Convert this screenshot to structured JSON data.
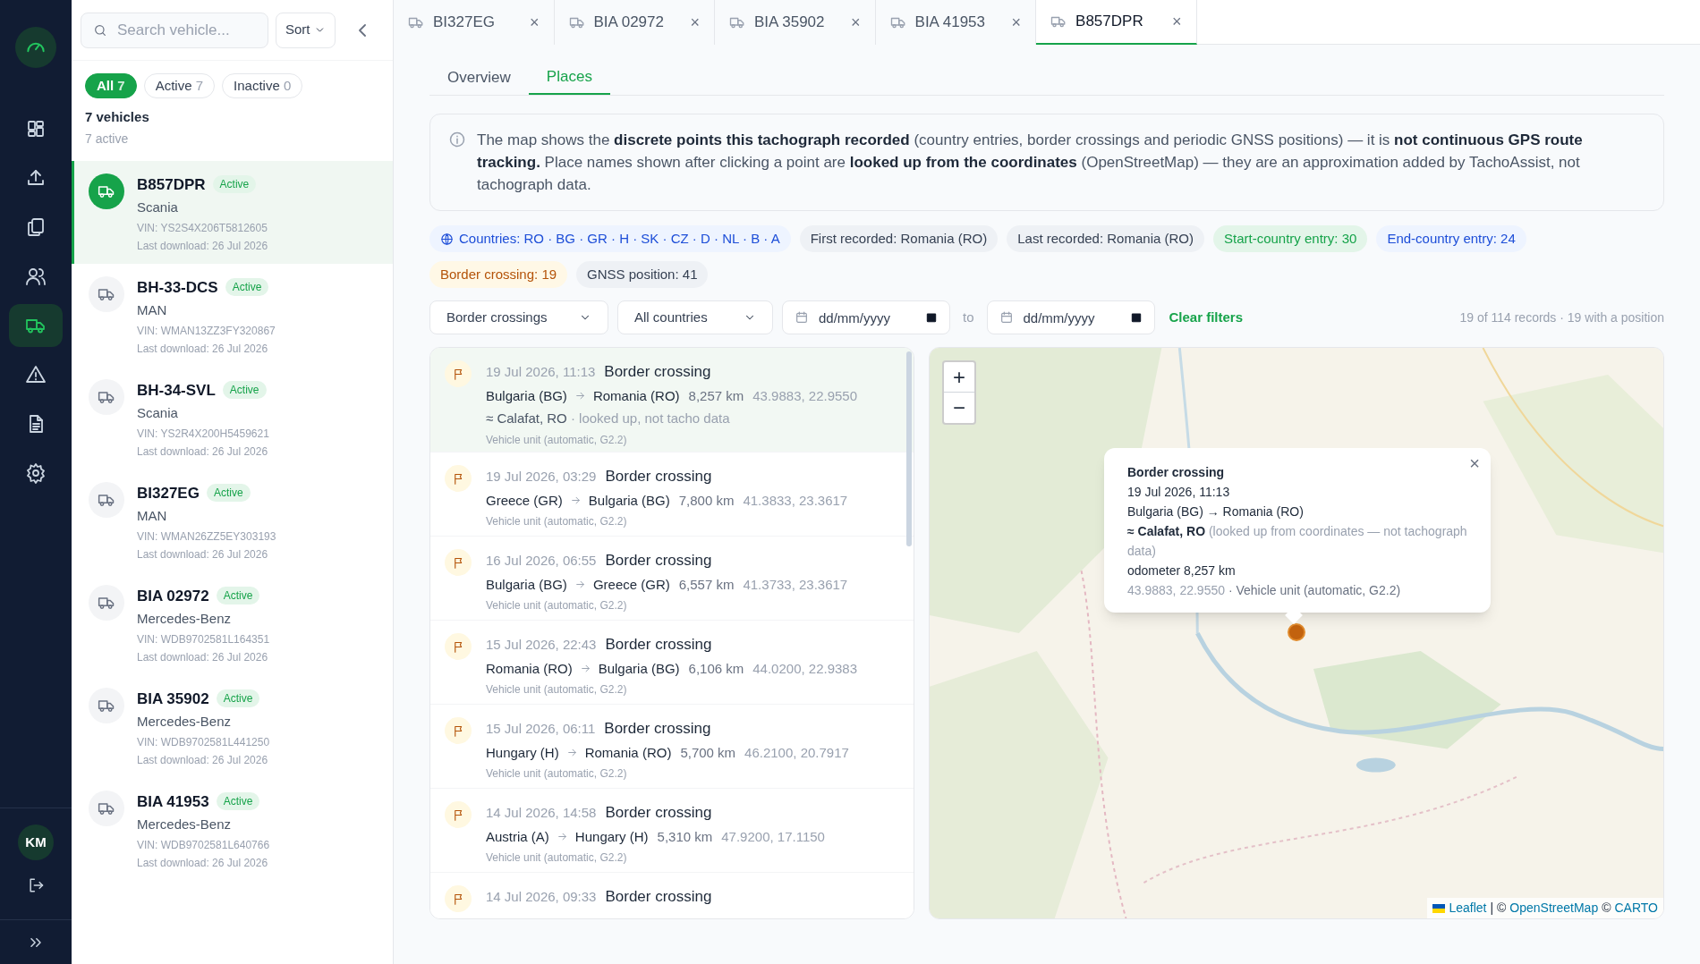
{
  "nav": {
    "items": [
      {
        "kind": "dashboard",
        "selected": false
      },
      {
        "kind": "upload",
        "selected": false
      },
      {
        "kind": "documents",
        "selected": false
      },
      {
        "kind": "drivers",
        "selected": false
      },
      {
        "kind": "vehicles",
        "selected": true
      },
      {
        "kind": "alerts",
        "selected": false
      },
      {
        "kind": "reports",
        "selected": false
      },
      {
        "kind": "settings",
        "selected": false
      }
    ],
    "avatar": "KM",
    "bottom": [
      {
        "kind": "logout"
      },
      {
        "kind": "expand"
      }
    ]
  },
  "vehicle_panel": {
    "search": {
      "placeholder": "Search vehicle..."
    },
    "sort": "Sort",
    "filters": [
      {
        "label": "All",
        "count": "7",
        "selected": true
      },
      {
        "label": "Active",
        "count": "7",
        "selected": false
      },
      {
        "label": "Inactive",
        "count": "0",
        "selected": false
      }
    ],
    "summary": "7 vehicles",
    "summary_sub": "7 active",
    "vehicles": [
      {
        "plate": "B857DPR",
        "status": "Active",
        "make": "Scania",
        "vin": "VIN: YS2S4X206T5812605",
        "last_download": "Last download: 26 Jul 2026",
        "selected": true
      },
      {
        "plate": "BH-33-DCS",
        "status": "Active",
        "make": "MAN",
        "vin": "VIN: WMAN13ZZ3FY320867",
        "last_download": "Last download: 26 Jul 2026",
        "selected": false
      },
      {
        "plate": "BH-34-SVL",
        "status": "Active",
        "make": "Scania",
        "vin": "VIN: YS2R4X200H5459621",
        "last_download": "Last download: 26 Jul 2026",
        "selected": false
      },
      {
        "plate": "BI327EG",
        "status": "Active",
        "make": "MAN",
        "vin": "VIN: WMAN26ZZ5EY303193",
        "last_download": "Last download: 26 Jul 2026",
        "selected": false
      },
      {
        "plate": "BIA 02972",
        "status": "Active",
        "make": "Mercedes-Benz",
        "vin": "VIN: WDB9702581L164351",
        "last_download": "Last download: 26 Jul 2026",
        "selected": false
      },
      {
        "plate": "BIA 35902",
        "status": "Active",
        "make": "Mercedes-Benz",
        "vin": "VIN: WDB9702581L441250",
        "last_download": "Last download: 26 Jul 2026",
        "selected": false
      },
      {
        "plate": "BIA 41953",
        "status": "Active",
        "make": "Mercedes-Benz",
        "vin": "VIN: WDB9702581L640766",
        "last_download": "Last download: 26 Jul 2026",
        "selected": false
      }
    ]
  },
  "tabs": [
    {
      "label": "BI327EG",
      "close": "×",
      "selected": false
    },
    {
      "label": "BIA 02972",
      "close": "×",
      "selected": false
    },
    {
      "label": "BIA 35902",
      "close": "×",
      "selected": false
    },
    {
      "label": "BIA 41953",
      "close": "×",
      "selected": false
    },
    {
      "label": "B857DPR",
      "close": "×",
      "selected": true
    }
  ],
  "subtabs": [
    {
      "label": "Overview",
      "selected": false
    },
    {
      "label": "Places",
      "selected": true
    }
  ],
  "info": "The map shows the **discrete points this tachograph recorded** (country entries, border crossings and periodic GNSS positions) — it is **not continuous GPS route tracking.** Place names shown after clicking a point are **looked up from the coordinates** (OpenStreetMap) — they are an approximation added by TachoAssist, not tachograph data.",
  "chips": [
    {
      "kind": "countries",
      "label": "Countries: RO · BG · GR · H · SK · CZ · D · NL · B · A"
    },
    {
      "kind": "neutral",
      "label": "First recorded: Romania (RO)"
    },
    {
      "kind": "neutral",
      "label": "Last recorded: Romania (RO)"
    },
    {
      "kind": "green",
      "label": "Start-country entry: 30"
    },
    {
      "kind": "blue",
      "label": "End-country entry: 24"
    },
    {
      "kind": "amber",
      "label": "Border crossing: 19"
    },
    {
      "kind": "neutral",
      "label": "GNSS position: 41"
    }
  ],
  "filter_bar": {
    "type_select": "Border crossings",
    "country_select": "All countries",
    "date_from": {
      "placeholder": "dd/mm/yyyy"
    },
    "to": "to",
    "date_to": {
      "placeholder": "dd/mm/yyyy"
    },
    "clear": "Clear filters",
    "records": "19 of 114 records · 19 with a position"
  },
  "events": [
    {
      "time": "19 Jul 2026, 11:13",
      "title": "Border crossing",
      "from": "Bulgaria (BG)",
      "to": "Romania (RO)",
      "km": "8,257 km",
      "coords": "43.9883, 22.9550",
      "place": "≈ Calafat, RO",
      "place_note": "· looked up, not tacho data",
      "source": "Vehicle unit (automatic, G2.2)",
      "selected": true
    },
    {
      "time": "19 Jul 2026, 03:29",
      "title": "Border crossing",
      "from": "Greece (GR)",
      "to": "Bulgaria (BG)",
      "km": "7,800 km",
      "coords": "41.3833, 23.3617",
      "source": "Vehicle unit (automatic, G2.2)",
      "selected": false
    },
    {
      "time": "16 Jul 2026, 06:55",
      "title": "Border crossing",
      "from": "Bulgaria (BG)",
      "to": "Greece (GR)",
      "km": "6,557 km",
      "coords": "41.3733, 23.3617",
      "source": "Vehicle unit (automatic, G2.2)",
      "selected": false
    },
    {
      "time": "15 Jul 2026, 22:43",
      "title": "Border crossing",
      "from": "Romania (RO)",
      "to": "Bulgaria (BG)",
      "km": "6,106 km",
      "coords": "44.0200, 22.9383",
      "source": "Vehicle unit (automatic, G2.2)",
      "selected": false
    },
    {
      "time": "15 Jul 2026, 06:11",
      "title": "Border crossing",
      "from": "Hungary (H)",
      "to": "Romania (RO)",
      "km": "5,700 km",
      "coords": "46.2100, 20.7917",
      "source": "Vehicle unit (automatic, G2.2)",
      "selected": false
    },
    {
      "time": "14 Jul 2026, 14:58",
      "title": "Border crossing",
      "from": "Austria (A)",
      "to": "Hungary (H)",
      "km": "5,310 km",
      "coords": "47.9200, 17.1150",
      "source": "Vehicle unit (automatic, G2.2)",
      "selected": false
    },
    {
      "time": "14 Jul 2026, 09:33",
      "title": "Border crossing",
      "selected": false
    }
  ],
  "map": {
    "kind": "picture",
    "zoom_in": "+",
    "zoom_out": "−",
    "popup": {
      "close": "×",
      "title": "Border crossing",
      "time": "19 Jul 2026, 11:13",
      "route": "Bulgaria (BG) → Romania (RO)",
      "place": "≈ Calafat, RO",
      "place_note": "(looked up from coordinates — not tachograph data)",
      "odometer": "odometer 8,257 km",
      "coords": "43.9883, 22.9550",
      "source": "· Vehicle unit (automatic, G2.2)"
    },
    "attribution": {
      "leaflet": "Leaflet",
      "sep": "| ©",
      "osm": "OpenStreetMap",
      "copy": "©",
      "carto": "CARTO"
    }
  }
}
